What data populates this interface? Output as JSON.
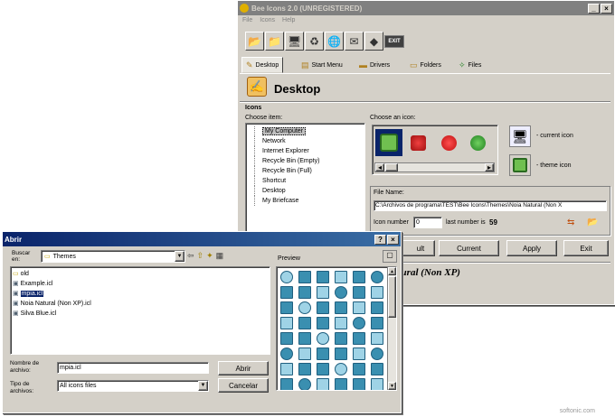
{
  "main": {
    "title": "Bee Icons 2.0 (UNREGISTERED)",
    "menu": [
      "File",
      "Icons",
      "Help"
    ],
    "toolbar": [
      {
        "icon": "folder-open-icon"
      },
      {
        "icon": "folder-icon"
      },
      {
        "icon": "computer-icon"
      },
      {
        "icon": "recycle-icon"
      },
      {
        "icon": "globe-icon"
      },
      {
        "icon": "mail-icon"
      },
      {
        "icon": "eraser-icon"
      }
    ],
    "exit_label": "EXIT",
    "tabs": [
      "Desktop",
      "Start Menu",
      "Drivers",
      "Folders",
      "Files"
    ],
    "section_title": "Desktop",
    "group_label": "Icons",
    "items_label": "Choose item:",
    "items": [
      "My Computer",
      "Network",
      "Internet Explorer",
      "Recycle Bin (Empty)",
      "Recycle Bin (Full)",
      "Shortcut",
      "Desktop",
      "My Briefcase"
    ],
    "icons_label": "Choose an icon:",
    "current_icon_label": "- current icon",
    "theme_icon_label": "- theme icon",
    "file_name_label": "File Name:",
    "file_path": "C:\\Archivos de programa\\TEST\\Bee Icons\\Themes\\Noia Natural (Non X",
    "icon_number_label": "Icon number",
    "icon_number": "0",
    "last_number_label": "last number is",
    "last_number": "59",
    "buttons": [
      "ult",
      "Current",
      "Apply",
      "Exit"
    ],
    "theme_caption": "atural (Non XP)"
  },
  "dialog": {
    "title": "Abrir",
    "look_in_label": "Buscar en:",
    "look_in_value": "Themes",
    "files": [
      "old",
      "Example.icl",
      "mpia.icl",
      "Noia Natural (Non XP).icl",
      "Silva Blue.icl"
    ],
    "selected_index": 2,
    "preview_label": "Preview",
    "file_name_label": "Nombre de archivo:",
    "file_name_value": "mpia.icl",
    "file_type_label": "Tipo de archivos:",
    "file_type_value": "All icons files",
    "open_button": "Abrir",
    "cancel_button": "Cancelar"
  },
  "watermark": "softonic.com"
}
